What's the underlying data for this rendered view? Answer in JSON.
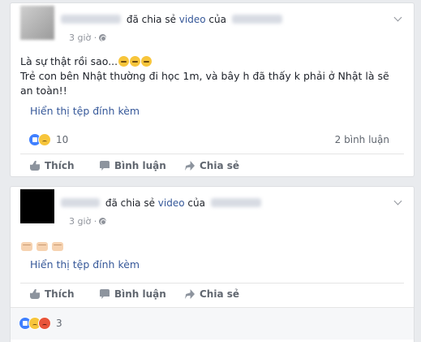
{
  "posts": [
    {
      "action_text": "đã chia sẻ",
      "object_link": "video",
      "of_text": "của",
      "time": "3 giờ ·",
      "lines": [
        "Là sự thật rồi sao...",
        "Trẻ con bên Nhật thường đi học 1m, và bây h đã thấy k phải ở Nhật là sẽ",
        "an toàn!!"
      ],
      "emoji": [
        "disappointed-emoji",
        "disappointed-emoji",
        "disappointed-emoji"
      ],
      "attachment_link": "Hiển thị tệp đính kèm",
      "reaction_count": "10",
      "comment_count": "2 bình luận",
      "actions": {
        "like": "Thích",
        "comment": "Bình luận",
        "share": "Chia sẻ"
      }
    },
    {
      "action_text": "đã chia sẻ",
      "object_link": "video",
      "of_text": "của",
      "time": "3 giờ ·",
      "emoji": [
        "fist-emoji",
        "fist-emoji",
        "fist-emoji"
      ],
      "attachment_link": "Hiển thị tệp đính kèm",
      "reaction_count": "3",
      "actions": {
        "like": "Thích",
        "comment": "Bình luận",
        "share": "Chia sẻ"
      }
    }
  ],
  "colors": {
    "link": "#365899",
    "like_reaction": "#4080ff",
    "sad_reaction": "#f7c53b",
    "angry_reaction": "#e9543a",
    "page_bg": "#e9ebee"
  },
  "icons": {
    "globe": "globe-icon",
    "options": "chevron-down-icon",
    "like": "thumbs-up-icon",
    "comment": "comment-icon",
    "share": "share-arrow-icon"
  }
}
